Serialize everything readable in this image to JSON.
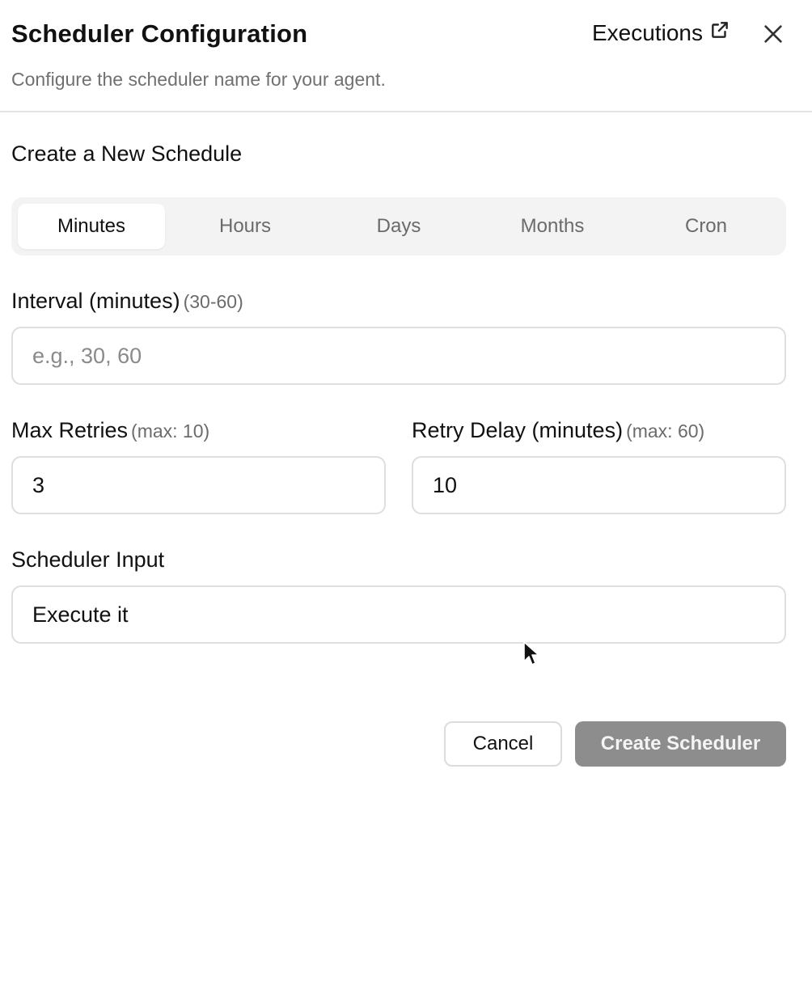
{
  "header": {
    "title": "Scheduler Configuration",
    "subtitle": "Configure the scheduler name for your agent.",
    "executions_label": "Executions",
    "external_link_icon": "external-link-icon",
    "close_icon": "close-icon"
  },
  "section_title": "Create a New Schedule",
  "tabs": [
    {
      "label": "Minutes",
      "active": true
    },
    {
      "label": "Hours",
      "active": false
    },
    {
      "label": "Days",
      "active": false
    },
    {
      "label": "Months",
      "active": false
    },
    {
      "label": "Cron",
      "active": false
    }
  ],
  "interval": {
    "label": "Interval (minutes)",
    "hint": "(30-60)",
    "placeholder": "e.g., 30, 60",
    "value": ""
  },
  "max_retries": {
    "label": "Max Retries",
    "hint": "(max: 10)",
    "value": "3"
  },
  "retry_delay": {
    "label": "Retry Delay (minutes)",
    "hint": "(max: 60)",
    "value": "10"
  },
  "scheduler_input": {
    "label": "Scheduler Input",
    "value": "Execute it"
  },
  "actions": {
    "cancel_label": "Cancel",
    "create_label": "Create Scheduler"
  },
  "colors": {
    "create_button_bg": "#8d8d8d",
    "tab_bar_bg": "#f3f3f3",
    "border": "#dedede",
    "muted_text": "#6b6b6b"
  }
}
